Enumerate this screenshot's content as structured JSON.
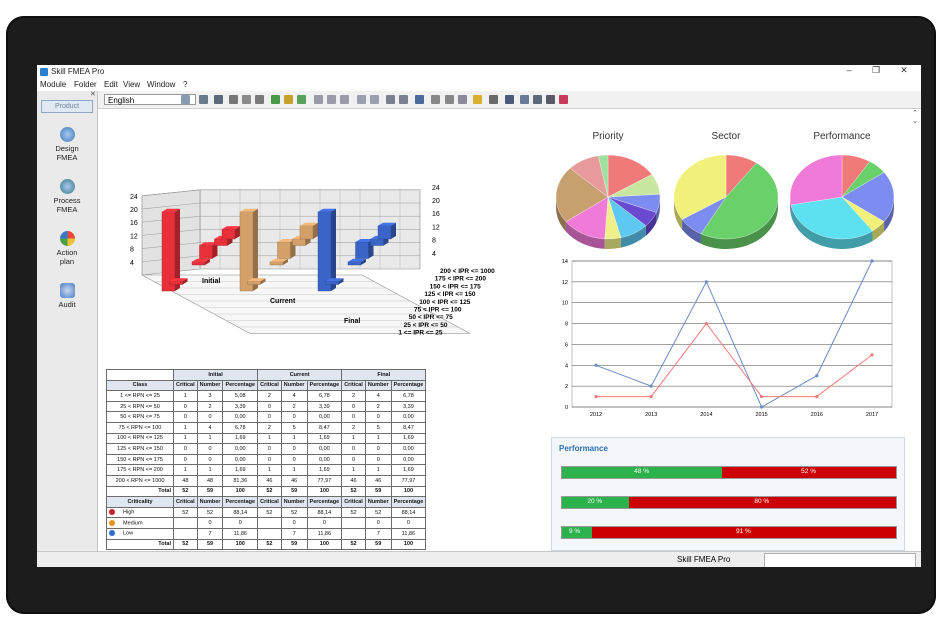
{
  "app": {
    "title": "Skill FMEA Pro",
    "menus": [
      "Module",
      "Folder",
      "Edit",
      "View",
      "Window",
      "?"
    ],
    "language": "English",
    "status": "Skill FMEA Pro"
  },
  "sidebar": {
    "tab": "Product",
    "items": [
      {
        "label1": "Design",
        "label2": "FMEA",
        "color": "#3a78b8"
      },
      {
        "label1": "Process",
        "label2": "FMEA",
        "color": "#4a8a3a"
      },
      {
        "label1": "Action",
        "label2": "plan",
        "color": "#c84a3a"
      },
      {
        "label1": "Audit",
        "label2": "",
        "color": "#4a7ec6"
      }
    ]
  },
  "bar3d": {
    "groups": [
      "Initial",
      "Current",
      "Final"
    ],
    "categories": [
      "1 <= IPR <= 25",
      "25 < IPR <= 50",
      "50 < IPR <= 75",
      "75 < IPR <= 100",
      "100 < IPR <= 125",
      "125 < IPR <= 150",
      "150 < IPR <= 175",
      "175 < IPR <= 200",
      "200 < IPR <= 1000"
    ],
    "values": {
      "Initial": [
        3,
        2,
        0,
        4,
        1,
        0,
        0,
        1,
        48
      ],
      "Current": [
        4,
        2,
        0,
        5,
        1,
        0,
        0,
        1,
        46
      ],
      "Final": [
        4,
        2,
        0,
        5,
        1,
        0,
        0,
        1,
        46
      ]
    },
    "left_ticks": [
      "4",
      "8",
      "12",
      "16",
      "20",
      "24"
    ],
    "right_ticks": [
      "4",
      "8",
      "12",
      "16",
      "20",
      "24"
    ],
    "colors": {
      "Initial": "#e8303a",
      "Current": "#d4a06a",
      "Final": "#3a64c8"
    }
  },
  "table": {
    "groups": [
      "Initial",
      "Current",
      "Final"
    ],
    "class_header": "Class",
    "sub_headers": [
      "Critical",
      "Number",
      "Percentage"
    ],
    "rows": [
      {
        "cls": "1 <= RPN <= 25",
        "v": [
          "1",
          "3",
          "5,08",
          "2",
          "4",
          "6,78",
          "2",
          "4",
          "6,78"
        ]
      },
      {
        "cls": "25 < RPN <= 50",
        "v": [
          "0",
          "2",
          "3,39",
          "0",
          "2",
          "3,39",
          "0",
          "2",
          "3,39"
        ]
      },
      {
        "cls": "50 < RPN <= 75",
        "v": [
          "0",
          "0",
          "0,00",
          "0",
          "0",
          "0,00",
          "0",
          "0",
          "0,00"
        ]
      },
      {
        "cls": "75 < RPN <= 100",
        "v": [
          "1",
          "4",
          "6,78",
          "2",
          "5",
          "8,47",
          "2",
          "5",
          "8,47"
        ]
      },
      {
        "cls": "100 < RPN <= 125",
        "v": [
          "1",
          "1",
          "1,69",
          "1",
          "1",
          "1,69",
          "1",
          "1",
          "1,69"
        ]
      },
      {
        "cls": "125 < RPN <= 150",
        "v": [
          "0",
          "0",
          "0,00",
          "0",
          "0",
          "0,00",
          "0",
          "0",
          "0,00"
        ]
      },
      {
        "cls": "150 < RPN <= 175",
        "v": [
          "0",
          "0",
          "0,00",
          "0",
          "0",
          "0,00",
          "0",
          "0",
          "0,00"
        ]
      },
      {
        "cls": "175 < RPN <= 200",
        "v": [
          "1",
          "1",
          "1,69",
          "1",
          "1",
          "1,69",
          "1",
          "1",
          "1,69"
        ]
      },
      {
        "cls": "200 < RPN <= 1000",
        "v": [
          "48",
          "48",
          "81,36",
          "46",
          "46",
          "77,97",
          "46",
          "46",
          "77,97"
        ]
      }
    ],
    "total_label": "Total",
    "total": [
      "52",
      "59",
      "100",
      "52",
      "59",
      "100",
      "52",
      "59",
      "100"
    ],
    "crit_header": "Criticality",
    "crit_rows": [
      {
        "label": "High",
        "color": "#d02020",
        "v": [
          "52",
          "52",
          "88,14",
          "52",
          "52",
          "88,14",
          "52",
          "52",
          "88,14"
        ]
      },
      {
        "label": "Medium",
        "color": "#e89020",
        "v": [
          "",
          "0",
          "0",
          "",
          "0",
          "0",
          "",
          "0",
          "0"
        ]
      },
      {
        "label": "Low",
        "color": "#2a6fd0",
        "v": [
          "",
          "7",
          "11,86",
          "",
          "7",
          "11,86",
          "",
          "7",
          "11,86"
        ]
      }
    ],
    "crit_total": [
      "52",
      "59",
      "100",
      "52",
      "59",
      "100",
      "52",
      "59",
      "100"
    ]
  },
  "pies": [
    {
      "title": "Priority",
      "slices": [
        {
          "v": 16,
          "c": "#f07a7a"
        },
        {
          "v": 8,
          "c": "#c8e6a0"
        },
        {
          "v": 7,
          "c": "#7d8cf0"
        },
        {
          "v": 6,
          "c": "#6a4ad0"
        },
        {
          "v": 9,
          "c": "#5dc8f0"
        },
        {
          "v": 5,
          "c": "#f0f08a"
        },
        {
          "v": 14,
          "c": "#f07ad8"
        },
        {
          "v": 22,
          "c": "#c8a070"
        },
        {
          "v": 10,
          "c": "#e69a9a"
        },
        {
          "v": 3,
          "c": "#a0e0a0"
        }
      ]
    },
    {
      "title": "Sector",
      "slices": [
        {
          "v": 10,
          "c": "#f07a7a"
        },
        {
          "v": 48,
          "c": "#6ad06a"
        },
        {
          "v": 8,
          "c": "#7d8cf0"
        },
        {
          "v": 34,
          "c": "#f0f07a"
        }
      ]
    },
    {
      "title": "Performance",
      "slices": [
        {
          "v": 9,
          "c": "#f07a7a"
        },
        {
          "v": 6,
          "c": "#6ad06a"
        },
        {
          "v": 20,
          "c": "#7d8cf0"
        },
        {
          "v": 5,
          "c": "#f0f07a"
        },
        {
          "v": 32,
          "c": "#5de0f0"
        },
        {
          "v": 28,
          "c": "#f07ad8"
        }
      ]
    }
  ],
  "chart_data": {
    "type": "line",
    "x": [
      "2012",
      "2013",
      "2014",
      "2015",
      "2016",
      "2017"
    ],
    "series": [
      {
        "values": [
          4,
          2,
          12,
          0,
          3,
          14
        ],
        "color": "#6a8ac8"
      },
      {
        "values": [
          1,
          1,
          8,
          1,
          1,
          5
        ],
        "color": "#f07a7a"
      }
    ],
    "yticks": [
      "0",
      "2",
      "4",
      "6",
      "8",
      "10",
      "12",
      "14"
    ],
    "ylim": [
      0,
      14
    ]
  },
  "performance": {
    "title": "Performance",
    "bars": [
      {
        "green": 48,
        "g_label": "48 %",
        "r_label": "52 %"
      },
      {
        "green": 20,
        "g_label": "20 %",
        "r_label": "80 %"
      },
      {
        "green": 9,
        "g_label": "9 %",
        "r_label": "91 %"
      }
    ]
  }
}
